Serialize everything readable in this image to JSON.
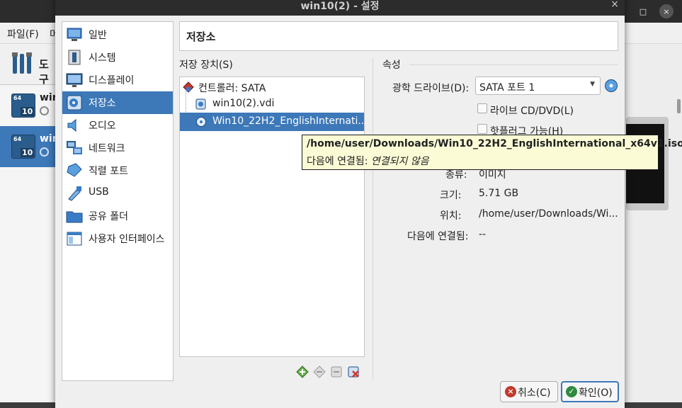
{
  "background_window": {
    "menu": [
      "파일(F)",
      "머"
    ],
    "tools_label": "도구",
    "vms": [
      {
        "name": "win",
        "badge_top": "64",
        "badge_bottom": "10"
      },
      {
        "name": "win",
        "badge_top": "64",
        "badge_bottom": "10"
      }
    ],
    "window_controls": {
      "maximize": "□",
      "close": "×"
    }
  },
  "dialog": {
    "title": "win10(2) - 설정",
    "close": "×",
    "sections": [
      {
        "label": "일반",
        "icon": "general-icon"
      },
      {
        "label": "시스템",
        "icon": "system-icon"
      },
      {
        "label": "디스플레이",
        "icon": "display-icon"
      },
      {
        "label": "저장소",
        "icon": "storage-icon",
        "active": true
      },
      {
        "label": "오디오",
        "icon": "audio-icon"
      },
      {
        "label": "네트워크",
        "icon": "network-icon"
      },
      {
        "label": "직렬 포트",
        "icon": "serial-port-icon"
      },
      {
        "label": "USB",
        "icon": "usb-icon"
      },
      {
        "label": "공유 폴더",
        "icon": "shared-folder-icon"
      },
      {
        "label": "사용자 인터페이스",
        "icon": "user-interface-icon"
      }
    ],
    "header_title": "저장소",
    "storage_devices_label": "저장 장치(S)",
    "tree": {
      "controller": "컨트롤러: SATA",
      "disk": "win10(2).vdi",
      "optical": "Win10_22H2_EnglishInternati..."
    },
    "attributes": {
      "label": "속성",
      "optical_drive_label": "광학 드라이브(D):",
      "optical_drive_value": "SATA 포트 1",
      "live_cd_label": "라이브 CD/DVD(L)",
      "hotplug_label": "핫플러그 가능(H)",
      "type_label": "종류:",
      "type_value": "이미지",
      "size_label": "크기:",
      "size_value": "5.71 GB",
      "location_label": "위치:",
      "location_value": "/home/user/Downloads/Wi...",
      "attached_label": "다음에 연결됨:",
      "attached_value": "--"
    },
    "tooltip": {
      "path": "/home/user/Downloads/Win10_22H2_EnglishInternational_x64v1.iso",
      "attached_prefix": "다음에 연결됨:",
      "attached_value": "연결되지 않음"
    },
    "buttons": {
      "cancel": "취소(C)",
      "ok": "확인(O)"
    }
  },
  "colors": {
    "selection": "#3d78b8",
    "tooltip_bg": "#fbfbd6"
  }
}
